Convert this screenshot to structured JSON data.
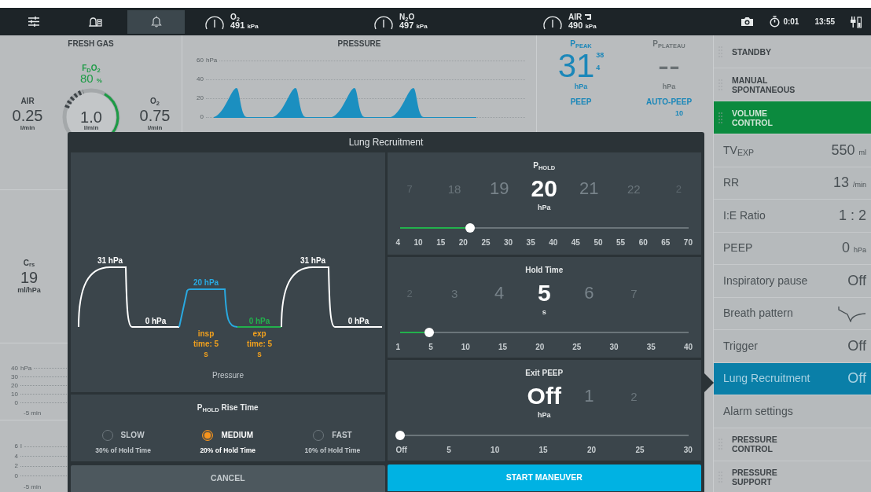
{
  "top_bar": {
    "buttons": [
      {
        "kind": "settings",
        "selected": false
      },
      {
        "kind": "alarm_list",
        "selected": false
      },
      {
        "kind": "alarm_silence",
        "selected": true
      }
    ],
    "gases": [
      {
        "label": "O$_{2}$",
        "reading": "491",
        "unit": "kPa",
        "kind": "plain"
      },
      {
        "label": "N$_{2}$O",
        "reading": "497",
        "unit": "kPa",
        "kind": "plain"
      },
      {
        "label": "AIR",
        "reading": "490",
        "unit": "kPa",
        "kind": "switch"
      }
    ],
    "timer": "0:01",
    "clock": "13:55"
  },
  "fresh_gas": {
    "title": "FRESH GAS",
    "fdo2": {
      "label": "F$_{D}$O$_{2}$",
      "value": "80",
      "unit": "%"
    },
    "air": {
      "label": "AIR",
      "value": "0.25",
      "unit": "l/min"
    },
    "total": {
      "value": "1.0",
      "unit": "l/min"
    },
    "o2": {
      "label": "O$_{2}$",
      "value": "0.75",
      "unit": "l/min"
    }
  },
  "compliance": {
    "label": "C$_{rs}$",
    "value": "19",
    "unit": "ml/hPa"
  },
  "trends": [
    {
      "unit": "hPa",
      "yticks": [
        "40",
        "30",
        "20",
        "10",
        "0"
      ],
      "xlabel": "-5 min"
    },
    {
      "unit": "l",
      "yticks": [
        "6",
        "4",
        "2",
        "0"
      ],
      "xlabel": "-5 min"
    }
  ],
  "pressure_chart": {
    "title": "PRESSURE",
    "unit": "hPa",
    "yticks": [
      "60",
      "40",
      "20",
      "0"
    ]
  },
  "measurements": [
    {
      "label": "P$_{PEAK}$",
      "value": "31",
      "max": "38",
      "min": "4",
      "unit": "hPa",
      "active": true
    },
    {
      "label": "P$_{PLATEAU}$",
      "value": "--",
      "unit": "hPa",
      "active": false
    },
    {
      "label": "PEEP",
      "active": true
    },
    {
      "label": "AUTO-PEEP",
      "max": "10",
      "active": true
    }
  ],
  "sidebar": [
    {
      "kind": "mode",
      "label": "STANDBY",
      "selected": false
    },
    {
      "kind": "mode",
      "label": "MANUAL SPONTANEOUS",
      "selected": false
    },
    {
      "kind": "mode",
      "label": "VOLUME CONTROL",
      "selected": true
    },
    {
      "kind": "setting",
      "label": "TV$_{EXP}$",
      "value": "550",
      "unit": "ml",
      "selected": false
    },
    {
      "kind": "setting",
      "label": "RR",
      "value": "13",
      "unit": "/min",
      "selected": false
    },
    {
      "kind": "setting",
      "label": "I:E Ratio",
      "value": "1 : 2",
      "selected": false
    },
    {
      "kind": "setting",
      "label": "PEEP",
      "value": "0",
      "unit": "hPa",
      "selected": false
    },
    {
      "kind": "setting",
      "label": "Inspiratory pause",
      "value": "Off",
      "selected": false
    },
    {
      "kind": "pattern",
      "label": "Breath pattern",
      "selected": false
    },
    {
      "kind": "setting",
      "label": "Trigger",
      "value": "Off",
      "selected": false
    },
    {
      "kind": "setting",
      "label": "Lung Recruitment",
      "value": "Off",
      "selected": true
    },
    {
      "kind": "setting",
      "label": "Alarm settings",
      "selected": false
    },
    {
      "kind": "mode",
      "label": "PRESSURE CONTROL",
      "selected": false
    },
    {
      "kind": "mode",
      "label": "PRESSURE SUPPORT",
      "selected": false
    }
  ],
  "dialog": {
    "title": "Lung Recruitment",
    "diagram": {
      "caption": "Pressure",
      "segments": [
        {
          "kind": "recruit",
          "label": "31 hPa"
        },
        {
          "kind": "rest",
          "label": "0 hPa"
        },
        {
          "kind": "hold",
          "label": "20 hPa",
          "time": "insp time: 5 s"
        },
        {
          "kind": "exit",
          "label": "0 hPa",
          "time": "exp time: 5 s"
        },
        {
          "kind": "recruit",
          "label": "31 hPa"
        },
        {
          "kind": "rest",
          "label": "0 hPa"
        }
      ]
    },
    "rise_time": {
      "title": "P$_{HOLD}$ Rise Time",
      "options": [
        {
          "label": "SLOW",
          "note": "30% of Hold Time",
          "selected": false
        },
        {
          "label": "MEDIUM",
          "note": "20% of Hold Time",
          "selected": true
        },
        {
          "label": "FAST",
          "note": "10% of Hold Time",
          "selected": false
        }
      ]
    },
    "pickers": [
      {
        "title": "P$_{HOLD}$",
        "unit": "hPa",
        "level": 0.242,
        "options": [
          {
            "value": "7",
            "selected": false
          },
          {
            "value": "18",
            "selected": false
          },
          {
            "value": "19",
            "selected": false
          },
          {
            "value": "20",
            "selected": true
          },
          {
            "value": "21",
            "selected": false
          },
          {
            "value": "22",
            "selected": false
          },
          {
            "value": "2",
            "selected": false
          }
        ],
        "ticks": [
          "4",
          "10",
          "15",
          "20",
          "25",
          "30",
          "35",
          "40",
          "45",
          "50",
          "55",
          "60",
          "65",
          "70"
        ]
      },
      {
        "title": "Hold Time",
        "unit": "s",
        "level": 0.103,
        "options": [
          {
            "value": "2",
            "selected": false
          },
          {
            "value": "3",
            "selected": false
          },
          {
            "value": "4",
            "selected": false
          },
          {
            "value": "5",
            "selected": true
          },
          {
            "value": "6",
            "selected": false
          },
          {
            "value": "7",
            "selected": false
          }
        ],
        "ticks": [
          "1",
          "5",
          "10",
          "15",
          "20",
          "25",
          "30",
          "35",
          "40"
        ]
      },
      {
        "title": "Exit PEEP",
        "unit": "hPa",
        "level": 0,
        "options": [
          {
            "value": "Off",
            "selected": true
          },
          {
            "value": "1",
            "selected": false
          },
          {
            "value": "2",
            "selected": false
          }
        ],
        "ticks": [
          "Off",
          "5",
          "10",
          "15",
          "20",
          "25",
          "30"
        ]
      }
    ],
    "buttons": [
      {
        "label": "CANCEL",
        "kind": "secondary"
      },
      {
        "label": "START MANEUVER",
        "kind": "primary"
      }
    ]
  }
}
